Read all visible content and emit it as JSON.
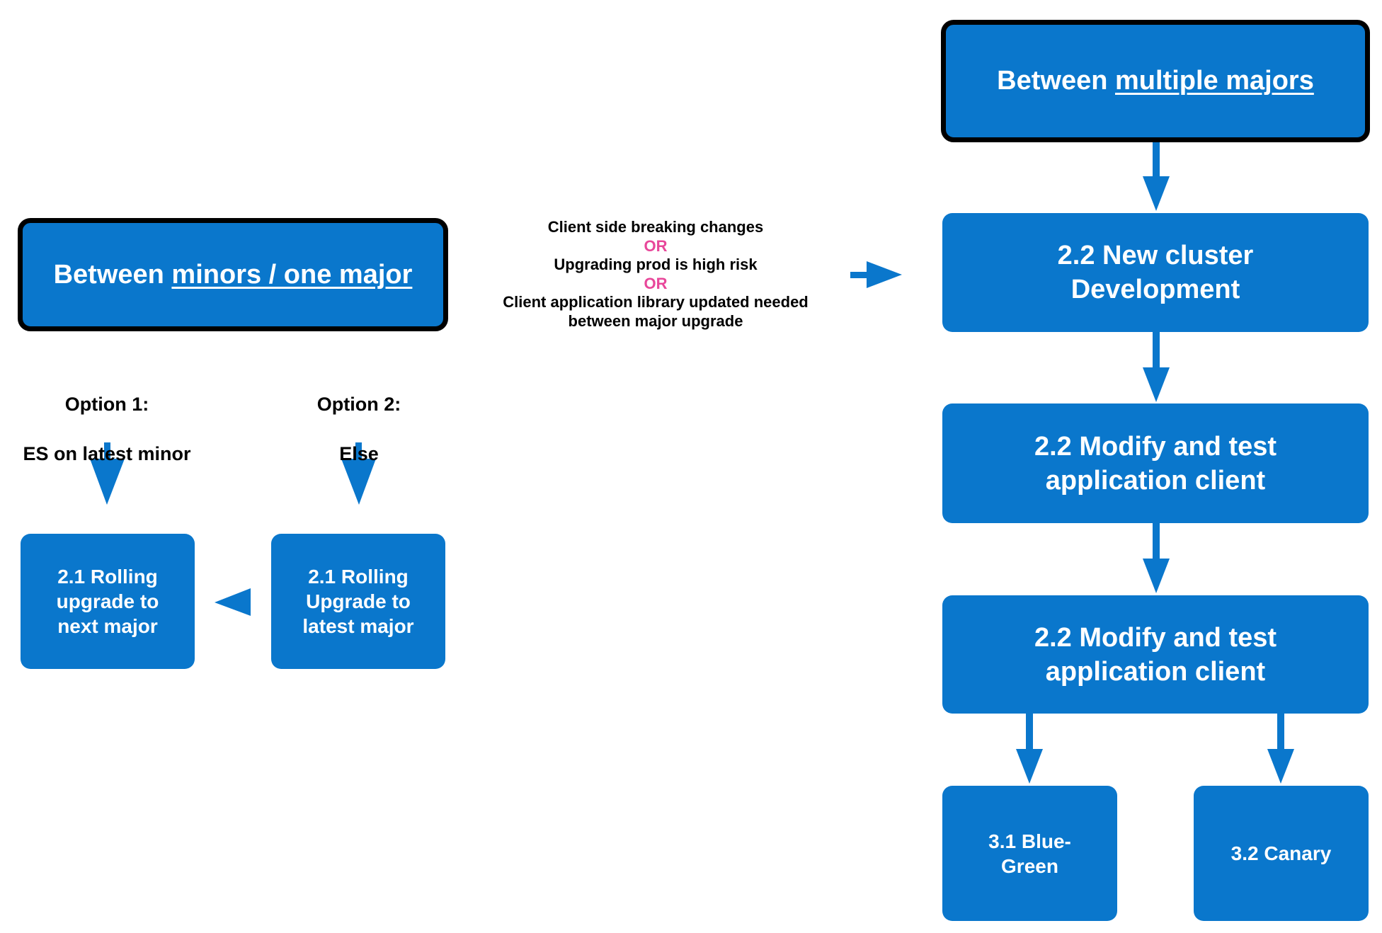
{
  "colors": {
    "box_fill": "#0a77cc",
    "box_text": "#ffffff",
    "outline": "#000000",
    "arrow": "#0a77cc",
    "or_text": "#e8479a",
    "label_text": "#000000"
  },
  "left": {
    "header": {
      "prefix": "Between ",
      "underlined": "minors / one major"
    },
    "option1": {
      "title": "Option 1:",
      "subtitle": "ES on latest minor"
    },
    "option2": {
      "title": "Option 2:",
      "subtitle": "Else"
    },
    "box_next_major": "2.1 Rolling\nupgrade to\nnext major",
    "box_latest_major": "2.1 Rolling\nUpgrade to\nlatest major"
  },
  "conditions": {
    "line1": "Client side breaking changes",
    "or1": "OR",
    "line2": "Upgrading prod is high risk",
    "or2": "OR",
    "line3": "Client application library updated needed",
    "line4": "between major upgrade"
  },
  "right": {
    "header": {
      "prefix": "Between ",
      "underlined": "multiple majors"
    },
    "step_new_cluster": "2.2 New cluster\nDevelopment",
    "step_modify_1": "2.2 Modify and test\napplication client",
    "step_modify_2": "2.2 Modify and test\napplication client",
    "box_blue_green": "3.1 Blue-\nGreen",
    "box_canary": "3.2 Canary"
  }
}
